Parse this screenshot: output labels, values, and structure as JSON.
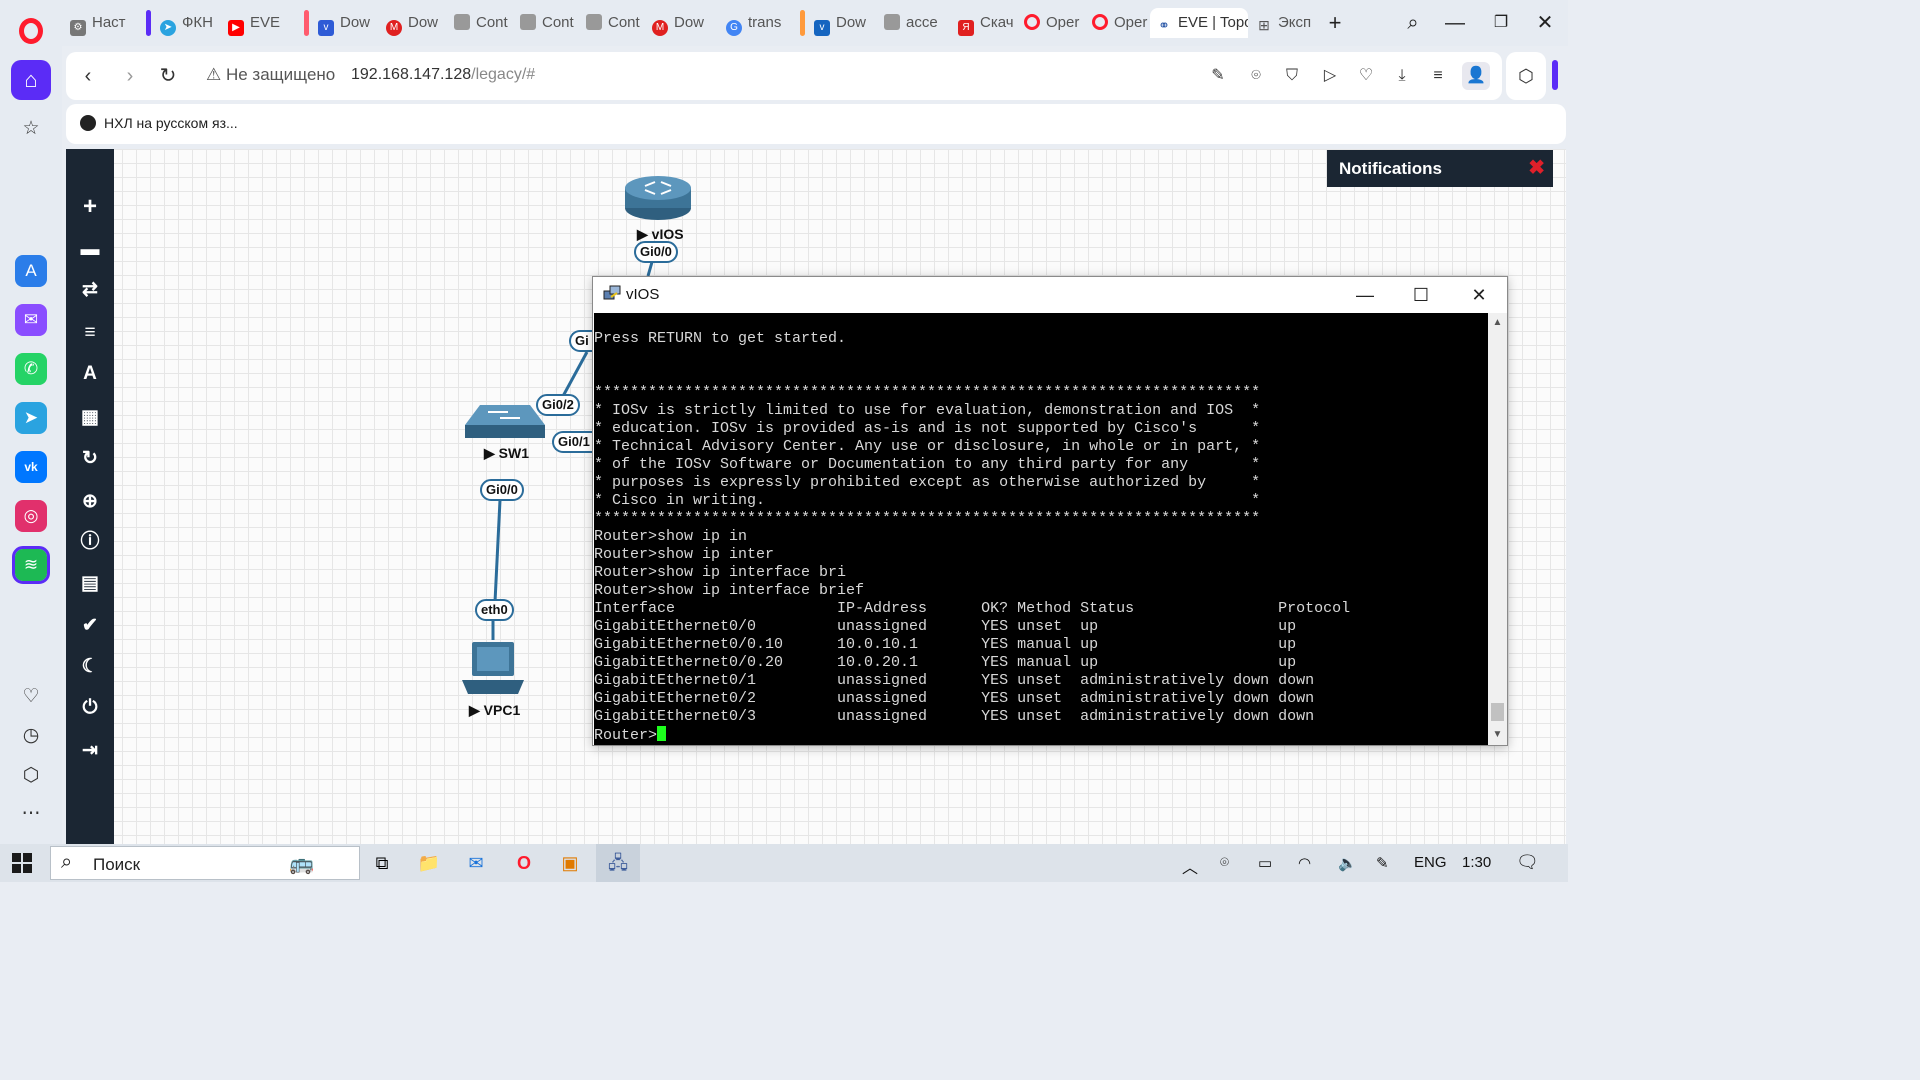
{
  "browser": {
    "tabs": [
      {
        "label": "Наст",
        "icon": "gear-icon"
      },
      {
        "label": "ФКН",
        "icon": "telegram-icon"
      },
      {
        "label": "EVE",
        "icon": "youtube-icon"
      },
      {
        "label": "Dow",
        "icon": "vc-icon"
      },
      {
        "label": "Dow",
        "icon": "m-icon"
      },
      {
        "label": "Cont",
        "icon": "page-icon"
      },
      {
        "label": "Cont",
        "icon": "page-icon"
      },
      {
        "label": "Cont",
        "icon": "page-icon"
      },
      {
        "label": "Dow",
        "icon": "m-icon"
      },
      {
        "label": "trans",
        "icon": "google-icon"
      },
      {
        "label": "Dow",
        "icon": "vmware-icon"
      },
      {
        "label": "acce",
        "icon": "page-icon"
      },
      {
        "label": "Скач",
        "icon": "yandex-icon"
      },
      {
        "label": "Oper",
        "icon": "opera-icon"
      },
      {
        "label": "Oper",
        "icon": "opera-icon"
      },
      {
        "label": "EVE | Topo",
        "icon": "eve-icon",
        "active": true
      },
      {
        "label": "Эксп",
        "icon": "grid-icon"
      }
    ],
    "address": {
      "warning": "Не защищено",
      "host": "192.168.147.128",
      "path": "/legacy/#"
    },
    "bookmark": "НХЛ на русском яз...",
    "accent_color": "#5b2cf6"
  },
  "eve": {
    "sidebar_icons": [
      "add-icon",
      "storage-icon",
      "transfer-icon",
      "list-icon",
      "text-icon",
      "grid-icon",
      "refresh-icon",
      "zoom-icon",
      "info-icon",
      "log-icon",
      "check-icon",
      "moon-icon",
      "power-icon",
      "logout-icon"
    ],
    "nodes": {
      "router": "vIOS",
      "switch": "SW1",
      "pc": "VPC1"
    },
    "ports": {
      "router_gi00": "Gi0/0",
      "sw_partial": "Gi",
      "sw_gi02": "Gi0/2",
      "sw_gi01": "Gi0/1",
      "sw_gi00": "Gi0/0",
      "pc_eth0": "eth0"
    },
    "notifications_title": "Notifications",
    "link_color": "#2b6c9a"
  },
  "terminal": {
    "title": "vIOS",
    "lines": [
      "Press RETURN to get started.",
      "",
      "",
      "**************************************************************************",
      "* IOSv is strictly limited to use for evaluation, demonstration and IOS  *",
      "* education. IOSv is provided as-is and is not supported by Cisco's      *",
      "* Technical Advisory Center. Any use or disclosure, in whole or in part, *",
      "* of the IOSv Software or Documentation to any third party for any       *",
      "* purposes is expressly prohibited except as otherwise authorized by     *",
      "* Cisco in writing.                                                      *",
      "**************************************************************************",
      "Router>show ip in",
      "Router>show ip inter",
      "Router>show ip interface bri",
      "Router>show ip interface brief",
      "Interface                  IP-Address      OK? Method Status                Protocol",
      "GigabitEthernet0/0         unassigned      YES unset  up                    up",
      "GigabitEthernet0/0.10      10.0.10.1       YES manual up                    up",
      "GigabitEthernet0/0.20      10.0.20.1       YES manual up                    up",
      "GigabitEthernet0/1         unassigned      YES unset  administratively down down",
      "GigabitEthernet0/2         unassigned      YES unset  administratively down down",
      "GigabitEthernet0/3         unassigned      YES unset  administratively down down"
    ],
    "prompt": "Router>",
    "cursor_color": "#1dff1d"
  },
  "taskbar": {
    "search_label": "Поиск",
    "lang": "ENG",
    "time": "1:30"
  }
}
